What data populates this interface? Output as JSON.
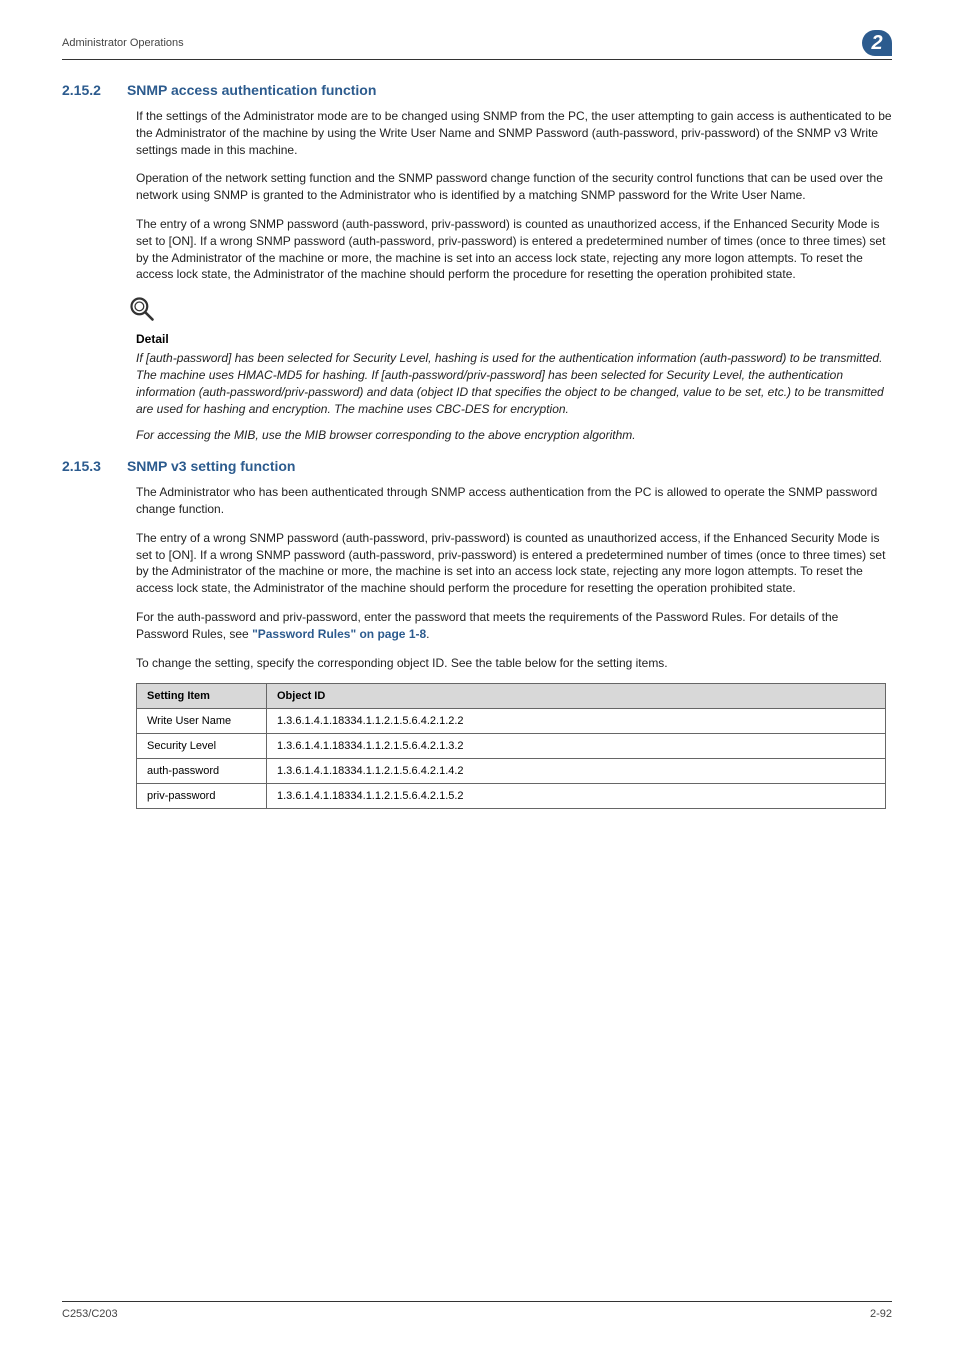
{
  "header": {
    "title": "Administrator Operations",
    "chapter": "2"
  },
  "sections": {
    "s1": {
      "number": "2.15.2",
      "title": "SNMP access authentication function",
      "p1": "If the settings of the Administrator mode are to be changed using SNMP from the PC, the user attempting to gain access is authenticated to be the Administrator of the machine by using the Write User Name and SNMP Password (auth-password, priv-password) of the SNMP v3 Write settings made in this machine.",
      "p2": "Operation of the network setting function and the SNMP password change function of the security control functions that can be used over the network using SNMP is granted to the Administrator who is identified by a matching SNMP password for the Write User Name.",
      "p3": "The entry of a wrong SNMP password (auth-password, priv-password) is counted as unauthorized access, if the Enhanced Security Mode is set to [ON]. If a wrong SNMP password (auth-password, priv-password) is entered a predetermined number of times (once to three times) set by the Administrator of the machine or more, the machine is set into an access lock state, rejecting any more logon attempts. To reset the access lock state, the Administrator of the machine should perform the procedure for resetting the operation prohibited state."
    },
    "detail": {
      "label": "Detail",
      "d1": "If [auth-password] has been selected for Security Level, hashing is used for the authentication information (auth-password) to be transmitted. The machine uses HMAC-MD5 for hashing. If [auth-password/priv-password] has been selected for Security Level, the authentication information (auth-password/priv-password) and data (object ID that specifies the object to be changed, value to be set, etc.) to be transmitted are used for hashing and encryption. The machine uses CBC-DES for encryption.",
      "d2": "For accessing the MIB, use the MIB browser corresponding to the above encryption algorithm."
    },
    "s2": {
      "number": "2.15.3",
      "title": "SNMP v3 setting function",
      "p1": "The Administrator who has been authenticated through SNMP access authentication from the PC is allowed to operate the SNMP password change function.",
      "p2": "The entry of a wrong SNMP password (auth-password, priv-password) is counted as unauthorized access, if the Enhanced Security Mode is set to [ON]. If a wrong SNMP password (auth-password, priv-password) is entered a predetermined number of times (once to three times) set by the Administrator of the machine or more, the machine is set into an access lock state, rejecting any more logon attempts. To reset the access lock state, the Administrator of the machine should perform the procedure for resetting the operation prohibited state.",
      "p3_before": "For the auth-password and priv-password, enter the password that meets the requirements of the Password Rules. For details of the Password Rules, see ",
      "p3_link": "\"Password Rules\" on page 1-8",
      "p3_after": ".",
      "p4": "To change the setting, specify the corresponding object ID. See the table below for the setting items."
    }
  },
  "table": {
    "headers": {
      "col1": "Setting Item",
      "col2": "Object ID"
    },
    "rows": [
      {
        "item": "Write User Name",
        "oid": "1.3.6.1.4.1.18334.1.1.2.1.5.6.4.2.1.2.2"
      },
      {
        "item": "Security Level",
        "oid": "1.3.6.1.4.1.18334.1.1.2.1.5.6.4.2.1.3.2"
      },
      {
        "item": "auth-password",
        "oid": "1.3.6.1.4.1.18334.1.1.2.1.5.6.4.2.1.4.2"
      },
      {
        "item": "priv-password",
        "oid": "1.3.6.1.4.1.18334.1.1.2.1.5.6.4.2.1.5.2"
      }
    ]
  },
  "footer": {
    "left": "C253/C203",
    "right": "2-92"
  }
}
